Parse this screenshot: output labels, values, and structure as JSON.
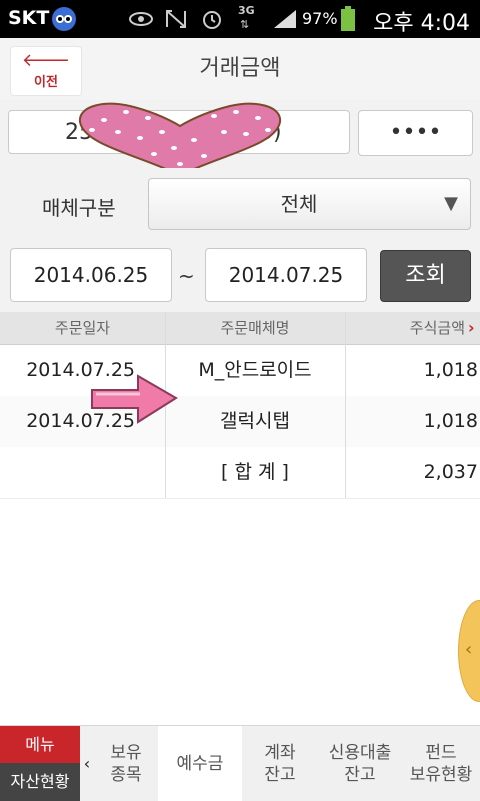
{
  "status_bar": {
    "carrier": "SKT",
    "network": "3G",
    "battery": "97%",
    "time": "오후 4:04"
  },
  "header": {
    "back_label": "이전",
    "title": "거래금액"
  },
  "account": {
    "number_partial": "25",
    "number_suffix": "3)",
    "password_mask": "••••"
  },
  "filters": {
    "media_label": "매체구분",
    "media_value": "전체",
    "start_date": "2014.06.25",
    "separator": "~",
    "end_date": "2014.07.25",
    "search_label": "조회"
  },
  "table": {
    "columns": [
      "주문일자",
      "주문매체명",
      "주식금액"
    ],
    "rows": [
      {
        "date": "2014.07.25",
        "media": "M_안드로이드",
        "amount": "1,018"
      },
      {
        "date": "2014.07.25",
        "media": "갤럭시탭",
        "amount": "1,018"
      },
      {
        "date": "",
        "media": "[ 합  계 ]",
        "amount": "2,037"
      }
    ]
  },
  "bottom_nav": {
    "menu_label": "메뉴",
    "asset_label": "자산현황",
    "items": [
      "보유\n종목",
      "예수금",
      "계좌\n잔고",
      "신용대출\n잔고",
      "펀드\n보유현황"
    ]
  },
  "colors": {
    "accent_red": "#c9262c",
    "search_button": "#555555",
    "sticker_heart": "#e07aa8",
    "sticker_arrow": "#f07aa8"
  }
}
